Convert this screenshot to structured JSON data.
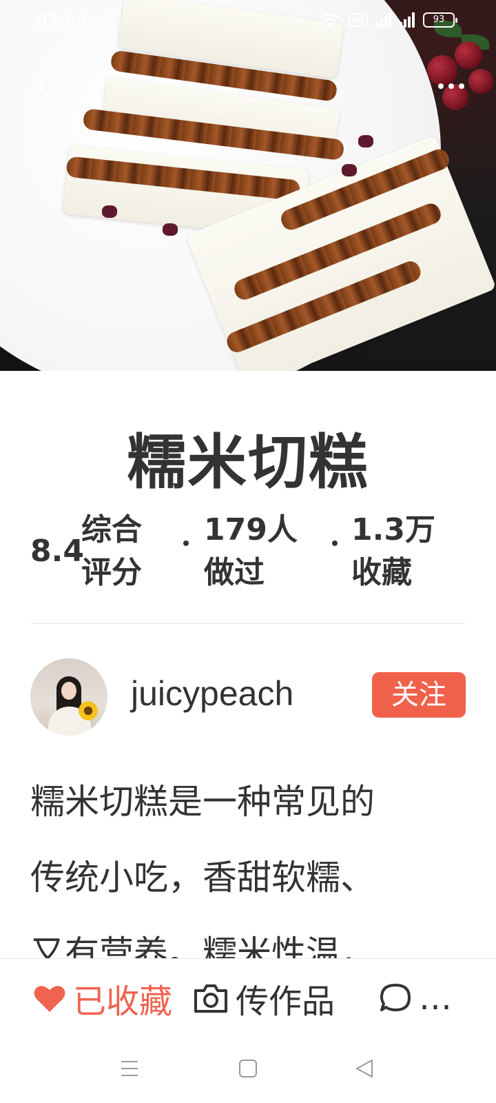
{
  "status_bar": {
    "time": "07:04",
    "network": "HD",
    "signal_1_label": "4G",
    "signal_2_label": "4G",
    "battery": "93"
  },
  "header": {
    "back_icon": "chevron-left-icon",
    "more_icon": "more-horizontal-icon"
  },
  "recipe": {
    "title": "糯米切糕",
    "score_value": "8.4",
    "score_label_1": "综合",
    "score_label_2": "评分",
    "made_value": "179人",
    "made_label": "做过",
    "fav_value": "1.3万",
    "fav_label": "收藏"
  },
  "author": {
    "name": "juicypeach",
    "follow_label": "关注"
  },
  "description": {
    "line1": "糯米切糕是一种常见的",
    "line2": "传统小吃，香甜软糯、",
    "line3": "又有营养。糯米性温，"
  },
  "actions": {
    "favorited_label": "已收藏",
    "upload_label": "传作品",
    "comment_label": "…"
  },
  "colors": {
    "accent": "#f0614b",
    "favorite": "#ef6451",
    "text": "#333333"
  }
}
